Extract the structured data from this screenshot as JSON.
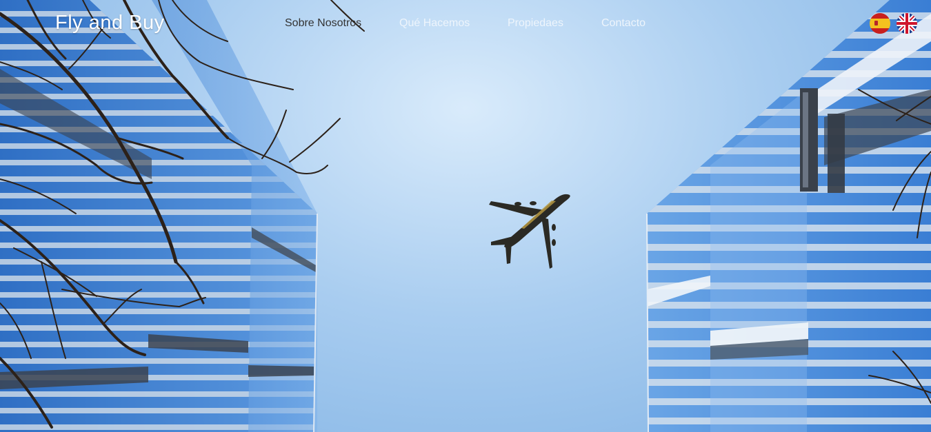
{
  "brand": {
    "logo": "Fly and Buy"
  },
  "nav": {
    "items": [
      {
        "label": "Sobre Nosotros",
        "active": true
      },
      {
        "label": "Qué Hacemos",
        "active": false
      },
      {
        "label": "Propiedaes",
        "active": false
      },
      {
        "label": "Contacto",
        "active": false
      }
    ]
  },
  "languages": [
    {
      "code": "es",
      "icon": "spain-flag-icon"
    },
    {
      "code": "en",
      "icon": "uk-flag-icon"
    }
  ],
  "hero": {
    "image": "airplane-between-glass-skyscrapers",
    "colors": {
      "sky": "#a9cdf0",
      "glass": "#3e82d6",
      "accent_text": "#333333"
    }
  }
}
